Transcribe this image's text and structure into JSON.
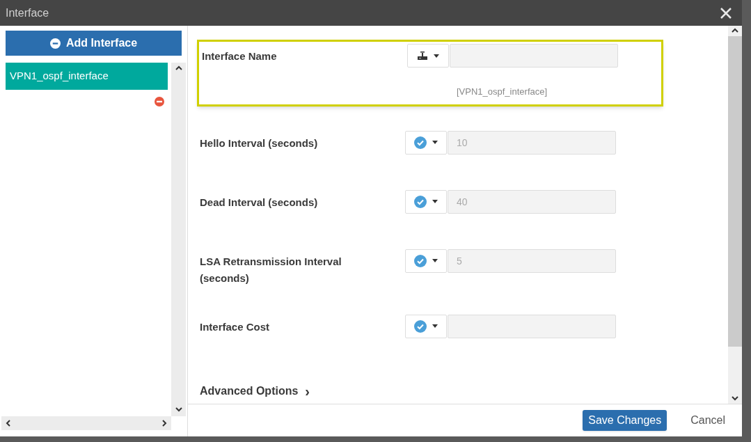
{
  "window": {
    "title": "Interface"
  },
  "add_button": {
    "label": "Add Interface"
  },
  "interfaces": [
    {
      "label": "VPN1_ospf_interface",
      "selected": true
    }
  ],
  "fields": [
    {
      "label": "Interface Name",
      "kind": "network",
      "hint": "[VPN1_ospf_interface]",
      "highlighted": true
    },
    {
      "label": "Hello Interval (seconds)",
      "kind": "check",
      "value": "10",
      "highlighted": false
    },
    {
      "label": "Dead Interval (seconds)",
      "kind": "check",
      "value": "40",
      "highlighted": false
    },
    {
      "label": "LSA Retransmission Interval (seconds)",
      "kind": "check",
      "value": "5",
      "highlighted": false
    },
    {
      "label": "Interface Cost",
      "kind": "check",
      "highlighted": false
    }
  ],
  "advanced": {
    "label": "Advanced Options",
    "glyph": "›"
  },
  "footer": {
    "save": "Save Changes",
    "cancel": "Cancel"
  }
}
